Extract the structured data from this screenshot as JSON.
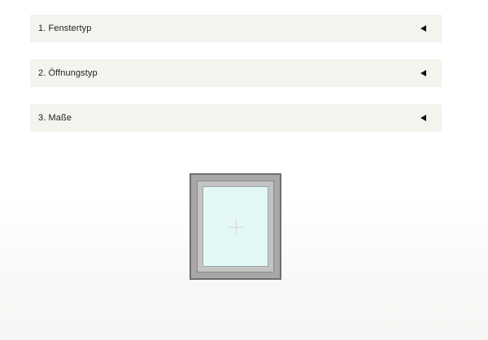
{
  "configurator": {
    "steps": [
      {
        "label": "1. Fenstertyp",
        "icon": "triangle-left-icon"
      },
      {
        "label": "2. Öffnungstyp",
        "icon": "triangle-left-icon"
      },
      {
        "label": "3. Maße",
        "icon": "triangle-left-icon"
      }
    ]
  },
  "preview": {
    "frame_color": "#a7a7a7",
    "glass_color": "#e3f7f6"
  }
}
